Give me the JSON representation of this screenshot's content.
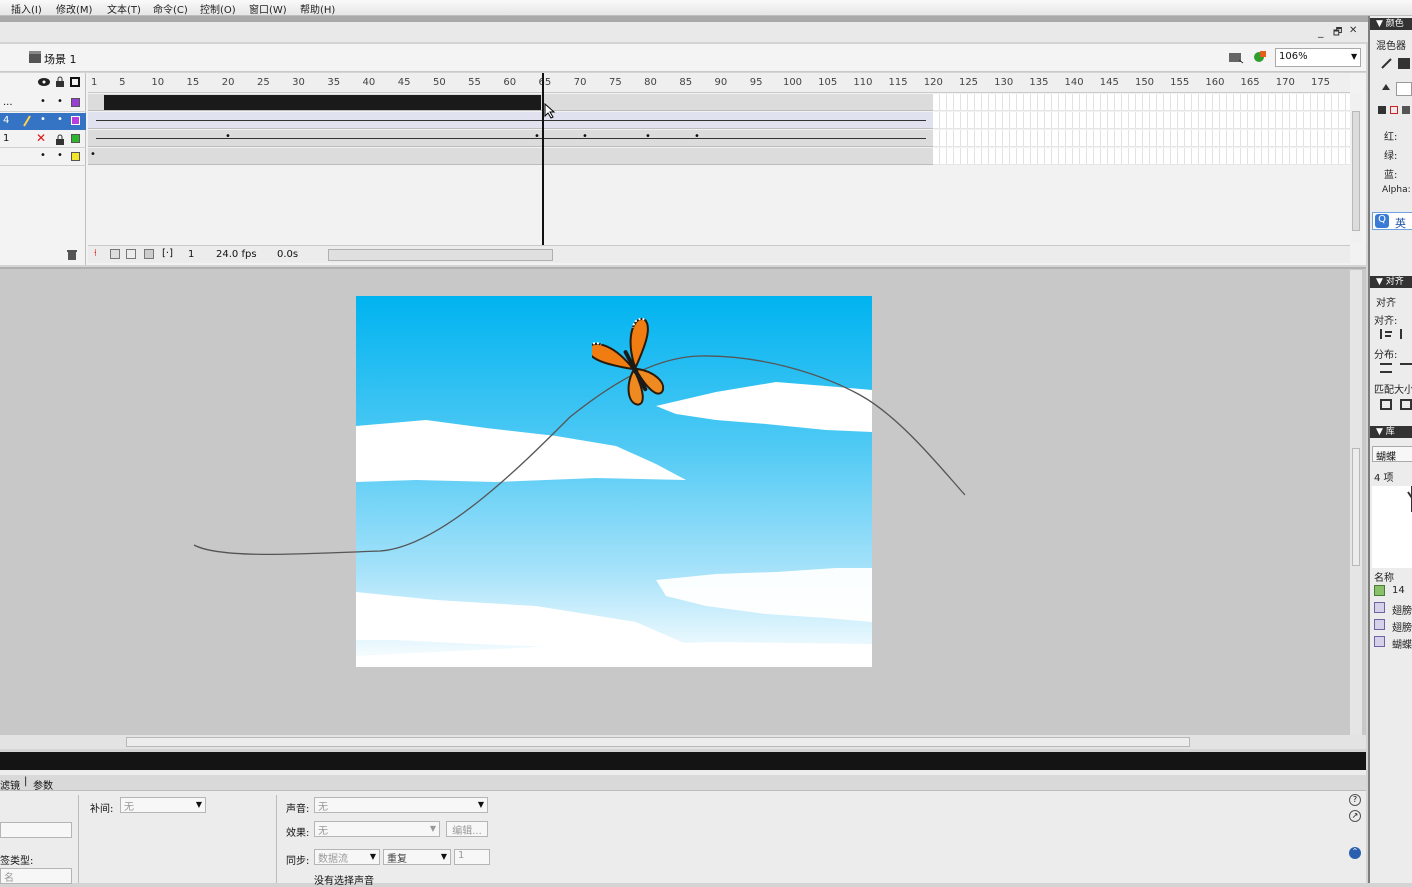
{
  "menu": {
    "items": [
      "插入(I)",
      "修改(M)",
      "文本(T)",
      "命令(C)",
      "控制(O)",
      "窗口(W)",
      "帮助(H)"
    ]
  },
  "window_controls": {
    "minimize": "_",
    "restore": "🗗",
    "close": "✕"
  },
  "scene": {
    "label": "场景 1",
    "zoom_value": "106%"
  },
  "timeline": {
    "ruler_labels": [
      "1",
      "5",
      "10",
      "15",
      "20",
      "25",
      "30",
      "35",
      "40",
      "45",
      "50",
      "55",
      "60",
      "65",
      "70",
      "75",
      "80",
      "85",
      "90",
      "95",
      "100",
      "105",
      "110",
      "115",
      "120",
      "125",
      "130",
      "135",
      "140",
      "145",
      "150",
      "155",
      "160",
      "165",
      "170",
      "175"
    ],
    "layers": [
      {
        "name": "...",
        "color": "#9b3fd4"
      },
      {
        "name": "4",
        "color": "#b93ee0",
        "selected": true
      },
      {
        "name": "1",
        "color": "#2db52d"
      },
      {
        "name": "",
        "color": "#f3e629"
      }
    ],
    "current_frame": "1",
    "fps": "24.0 fps",
    "elapsed": "0.0s",
    "playhead_frame": 65
  },
  "properties": {
    "tabs_label": "滤镜",
    "params_label": "参数",
    "tween_label": "补间:",
    "tween_value": "无",
    "sound_label": "声音:",
    "sound_value": "无",
    "effect_label": "效果:",
    "effect_value": "无",
    "edit_button": "编辑...",
    "sync_label": "同步:",
    "sync_value": "数据流",
    "repeat_value": "重复",
    "repeat_count": "1",
    "no_sound_text": "没有选择声音",
    "label_type": "签类型:",
    "label_type_value": "名"
  },
  "right_panel": {
    "color_header": "颜色",
    "mixer_label": "混色器",
    "red_label": "红:",
    "green_label": "绿:",
    "blue_label": "蓝:",
    "alpha_label": "Alpha:",
    "ime_label": "英",
    "align_header": "对齐",
    "align_label": "对齐",
    "align_to": "对齐:",
    "distribute": "分布:",
    "match_size": "匹配大小",
    "library_header": "库",
    "library_dropdown": "蝴蝶",
    "item_count": "4 项",
    "name_col": "名称",
    "lib_items": [
      "14",
      "翅膀",
      "翅膀",
      "蝴蝶"
    ]
  },
  "colors": {
    "sky_top": "#00b3f0",
    "sky_bottom": "#ffffff",
    "stage_bg": "#c8c8c8",
    "butterfly_orange": "#f07c12"
  }
}
